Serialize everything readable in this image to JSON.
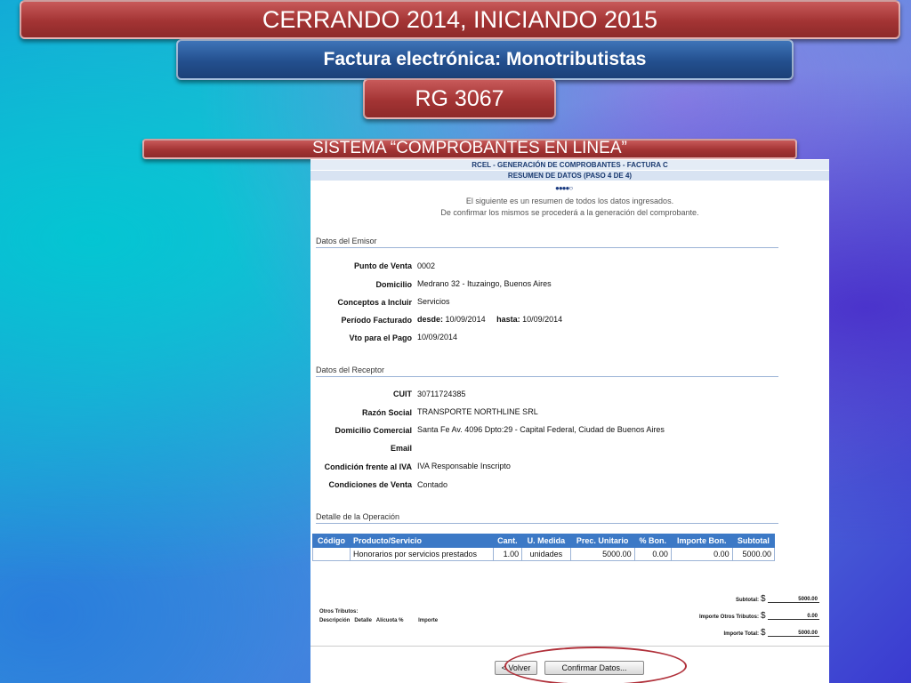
{
  "slide": {
    "title": "CERRANDO 2014, INICIANDO 2015",
    "subtitle": "Factura electrónica: Monotributistas",
    "rg": "RG 3067",
    "system": "SISTEMA “COMPROBANTES EN LINEA”"
  },
  "form": {
    "header1": "RCEL - GENERACIÓN DE COMPROBANTES - FACTURA C",
    "header2": "RESUMEN DE DATOS (PASO 4 DE 4)",
    "step_dots": "●●●●○",
    "intro1": "El siguiente es un resumen de todos los datos ingresados.",
    "intro2": "De confirmar los mismos se procederá a la generación del comprobante.",
    "emisor": {
      "section": "Datos del Emisor",
      "punto_venta_label": "Punto de Venta",
      "punto_venta": "0002",
      "domicilio_label": "Domicilio",
      "domicilio": "Medrano 32 - Ituzaingo, Buenos Aires",
      "conceptos_label": "Conceptos a Incluir",
      "conceptos": "Servicios",
      "periodo_label": "Período Facturado",
      "periodo_desde_label": "desde:",
      "periodo_desde": "10/09/2014",
      "periodo_hasta_label": "hasta:",
      "periodo_hasta": "10/09/2014",
      "vto_label": "Vto para el Pago",
      "vto": "10/09/2014"
    },
    "receptor": {
      "section": "Datos del Receptor",
      "cuit_label": "CUIT",
      "cuit": "30711724385",
      "razon_label": "Razón Social",
      "razon": "TRANSPORTE NORTHLINE SRL",
      "domicilio_label": "Domicilio Comercial",
      "domicilio": "Santa Fe Av. 4096 Dpto:29 - Capital Federal, Ciudad de Buenos Aires",
      "email_label": "Email",
      "email": "",
      "iva_label": "Condición frente al IVA",
      "iva": "IVA Responsable Inscripto",
      "condiciones_label": "Condiciones de Venta",
      "condiciones": "Contado"
    },
    "operacion": {
      "section": "Detalle de la Operación",
      "columns": [
        "Código",
        "Producto/Servicio",
        "Cant.",
        "U. Medida",
        "Prec. Unitario",
        "% Bon.",
        "Importe Bon.",
        "Subtotal"
      ],
      "row": {
        "codigo": "",
        "producto": "Honorarios por servicios prestados",
        "cant": "1.00",
        "medida": "unidades",
        "precio": "5000.00",
        "bon_pct": "0.00",
        "bon_imp": "0.00",
        "subtotal": "5000.00"
      }
    },
    "totales": {
      "subtotal_label": "Subtotal:",
      "subtotal": "5000.00",
      "otros_label": "Importe Otros Tributos:",
      "otros": "0.00",
      "total_label": "Importe Total:",
      "total": "5000.00",
      "currency": "$"
    },
    "otros_tributos": {
      "title": "Otros Tributos:",
      "headers": "Descripción   Detalle   Alícuota %          Importe"
    },
    "buttons": {
      "volver": "< Volver",
      "confirmar": "Confirmar Datos..."
    }
  },
  "colors": {
    "banner_red": "#a33434",
    "banner_blue": "#234f8e",
    "table_header": "#3c79c6",
    "highlight_oval": "#b0303a"
  }
}
